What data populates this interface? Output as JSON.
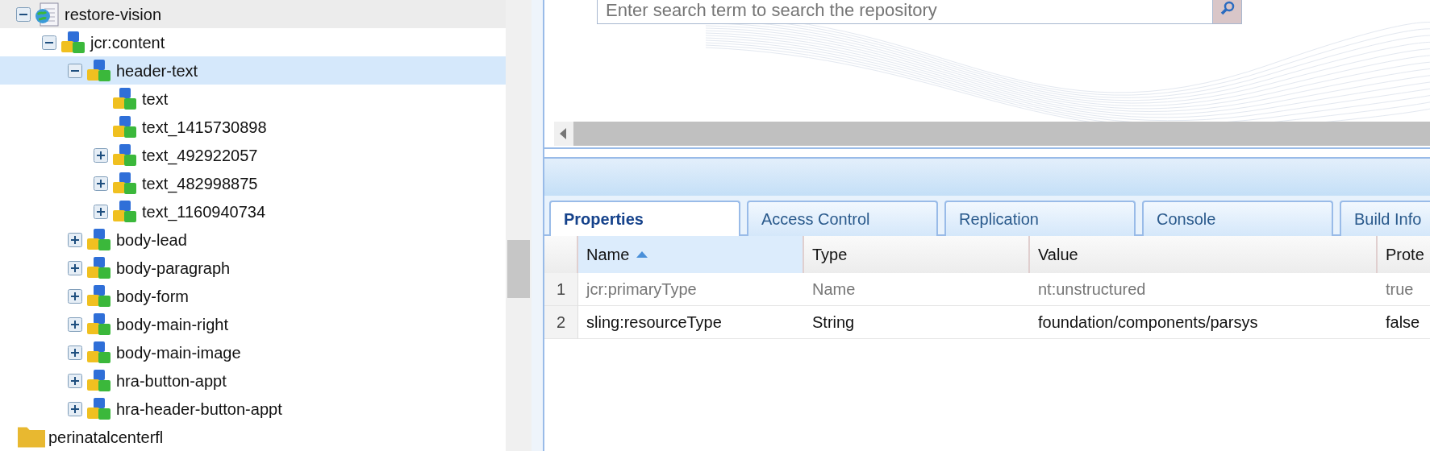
{
  "tree": [
    {
      "label": "restore-vision",
      "kind": "page",
      "expanded": true,
      "selected": false,
      "hovered": true,
      "children": [
        {
          "label": "jcr:content",
          "kind": "node",
          "expanded": true,
          "selected": false,
          "hovered": false,
          "children": [
            {
              "label": "header-text",
              "kind": "node",
              "expanded": true,
              "selected": true,
              "hovered": false,
              "children": [
                {
                  "label": "text",
                  "kind": "node",
                  "selected": false,
                  "hovered": false
                },
                {
                  "label": "text_1415730898",
                  "kind": "node",
                  "selected": false,
                  "hovered": false
                },
                {
                  "label": "text_492922057",
                  "kind": "node",
                  "expanded": false,
                  "selected": false,
                  "hovered": false
                },
                {
                  "label": "text_482998875",
                  "kind": "node",
                  "expanded": false,
                  "selected": false,
                  "hovered": false
                },
                {
                  "label": "text_1160940734",
                  "kind": "node",
                  "expanded": false,
                  "selected": false,
                  "hovered": false
                }
              ]
            },
            {
              "label": "body-lead",
              "kind": "node",
              "expanded": false,
              "selected": false,
              "hovered": false
            },
            {
              "label": "body-paragraph",
              "kind": "node",
              "expanded": false,
              "selected": false,
              "hovered": false
            },
            {
              "label": "body-form",
              "kind": "node",
              "expanded": false,
              "selected": false,
              "hovered": false
            },
            {
              "label": "body-main-right",
              "kind": "node",
              "expanded": false,
              "selected": false,
              "hovered": false
            },
            {
              "label": "body-main-image",
              "kind": "node",
              "expanded": false,
              "selected": false,
              "hovered": false
            },
            {
              "label": "hra-button-appt",
              "kind": "node",
              "expanded": false,
              "selected": false,
              "hovered": false
            },
            {
              "label": "hra-header-button-appt",
              "kind": "node",
              "expanded": false,
              "selected": false,
              "hovered": false
            }
          ]
        }
      ]
    }
  ],
  "tree_after": [
    {
      "label": "perinatalcenterfl",
      "kind": "folder",
      "selected": false,
      "hovered": false
    }
  ],
  "search": {
    "placeholder": "Enter search term to search the repository"
  },
  "tabs": [
    {
      "label": "Properties",
      "selected": true
    },
    {
      "label": "Access Control",
      "selected": false
    },
    {
      "label": "Replication",
      "selected": false
    },
    {
      "label": "Console",
      "selected": false
    },
    {
      "label": "Build Info",
      "selected": false
    }
  ],
  "table": {
    "columns": [
      {
        "label": "Name",
        "sorted": true
      },
      {
        "label": "Type",
        "sorted": false
      },
      {
        "label": "Value",
        "sorted": false
      },
      {
        "label": "Prote",
        "sorted": false
      }
    ],
    "rows": [
      {
        "number": "1",
        "greyed": true,
        "cells": [
          "jcr:primaryType",
          "Name",
          "nt:unstructured",
          "true"
        ]
      },
      {
        "number": "2",
        "greyed": false,
        "cells": [
          "sling:resourceType",
          "String",
          "foundation/components/parsys",
          "false"
        ]
      }
    ]
  }
}
